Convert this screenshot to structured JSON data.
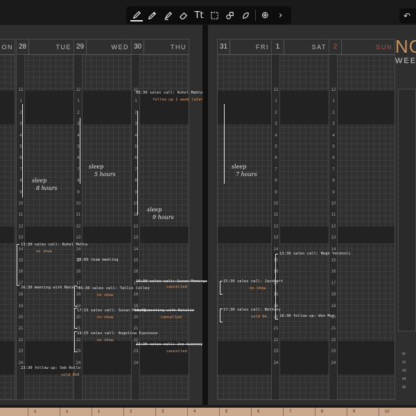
{
  "toolbar": {
    "tools": [
      "pen-icon",
      "pencil-icon",
      "highlighter-icon",
      "eraser-icon",
      "text-icon",
      "lasso-icon",
      "shape-icon",
      "sticker-icon"
    ],
    "text_tool_glyph": "Tt",
    "add_glyph": "⊕",
    "next_glyph": "›",
    "undo_glyph": "↶"
  },
  "left_days": [
    {
      "date": "",
      "dow": "MON",
      "dow_visible": "ON"
    },
    {
      "date": "28",
      "dow": "TUE"
    },
    {
      "date": "29",
      "dow": "WED"
    },
    {
      "date": "30",
      "dow": "THU"
    }
  ],
  "right_days": [
    {
      "date": "31",
      "dow": "FRI"
    },
    {
      "date": "1",
      "dow": "SAT"
    },
    {
      "date": "2",
      "dow": "SUN"
    }
  ],
  "hour_labels": [
    "12",
    "1",
    "2",
    "3",
    "4",
    "5",
    "6",
    "7",
    "8",
    "9",
    "10",
    "11",
    "12",
    "13",
    "14",
    "15",
    "16",
    "17",
    "18",
    "19",
    "20",
    "21",
    "22",
    "23",
    "24"
  ],
  "handwriting": {
    "mon_sleep": "sleep",
    "mon_hours": "8 hours",
    "tue_sleep": "sleep",
    "tue_hours": "5 hours",
    "thu_sleep": "sleep",
    "thu_hours": "9 hours",
    "fri_sleep": "sleep",
    "fri_hours": "7 hours"
  },
  "notes": {
    "thu_1": "00:30 sales call: Kohel Mahta",
    "thu_2": "follow up 1 week later",
    "mon_1": "13:30 sales call: Kohel Mehta",
    "mon_2": "no show",
    "mon_3": "16:30 meeting with Natalie",
    "tue_1": "15:00 team meeting",
    "tue_2": "16:30 sales call: Tallis Colley",
    "tue_3": "no show",
    "tue_4": "17:15 sales call: Susan Memarga",
    "tue_5": "no show",
    "tue_6": "19:15 sales call: Angelina Espinoza",
    "tue_7": "no show",
    "thu_3": "16:30 sales call: Susan Memarga",
    "thu_4": "cancelled",
    "thu_5": "19:00 meeting with Natalie",
    "thu_6": "cancelled",
    "thu_7": "22:30 sales call: Joe Sweeney",
    "thu_8": "cancelled",
    "mon_4": "23:30 follow up: Seb Rollo",
    "mon_5": "sold 0k8",
    "sat_1": "13:30 sales call: Negn Valenoli",
    "fri_1": "15:30 sales call: Jacobert",
    "fri_2": "no show",
    "fri_3": "17:30 sales call: Bethany",
    "fri_4": "sold 6k",
    "sat_2": "18:30 follow up: Won Mun"
  },
  "side": {
    "title": "NO",
    "subtitle": "WEE",
    "rows": [
      "W",
      "41",
      "43",
      "44",
      "45"
    ]
  },
  "ruler": [
    "o",
    "o",
    "1",
    "2",
    "3",
    "4",
    "5",
    "6",
    "7",
    "8",
    "9",
    "10"
  ],
  "colors": {
    "accent": "#c9935f",
    "note_orange": "#e7a06b",
    "sunday": "#c0504d"
  }
}
